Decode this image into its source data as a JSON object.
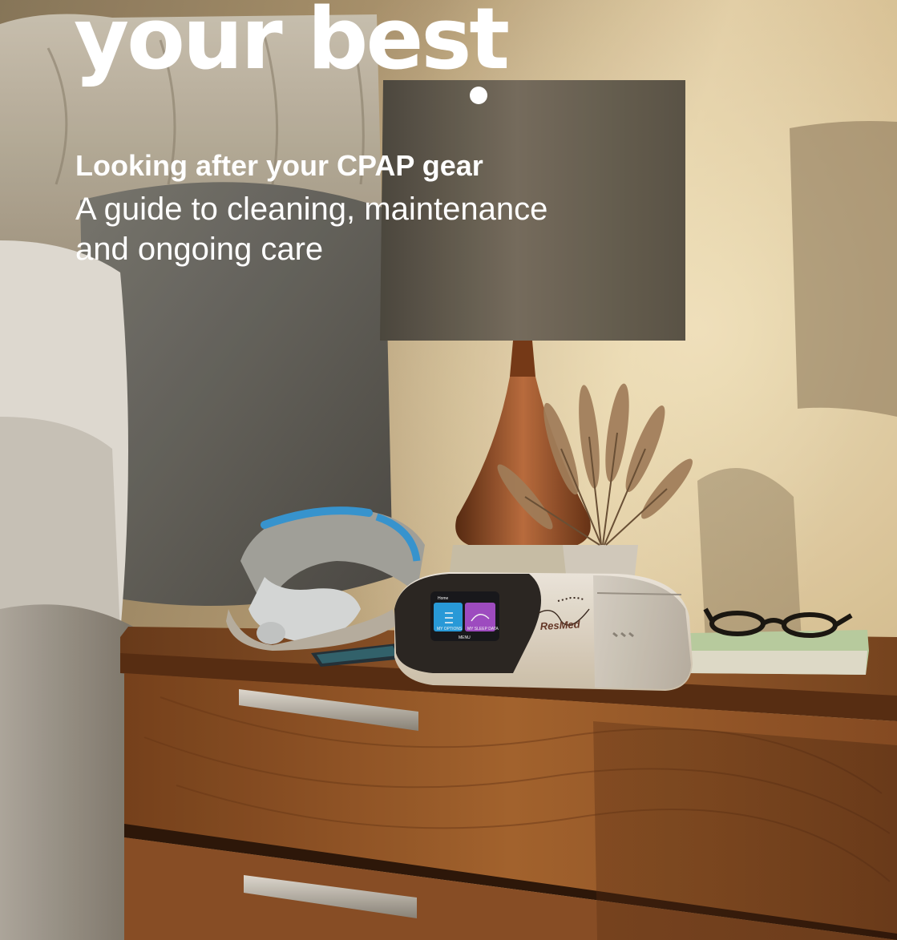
{
  "hero": {
    "headline": "your best",
    "subtitle": "Looking after your CPAP gear",
    "description": "A guide to cleaning, maintenance and ongoing care"
  },
  "device": {
    "brand": "ResMed",
    "screen_title": "Home",
    "screen_tile_left": "MY OPTIONS",
    "screen_tile_right": "MY SLEEP DATA",
    "screen_button": "MENU"
  },
  "colors": {
    "headline_text": "#ffffff",
    "wall_light": "#e8d5b0",
    "wood": "#8a4f26",
    "screen_tile_blue": "#2aa0e0",
    "screen_tile_purple": "#a44fc7",
    "mask_strap_blue": "#3a9ad6"
  }
}
